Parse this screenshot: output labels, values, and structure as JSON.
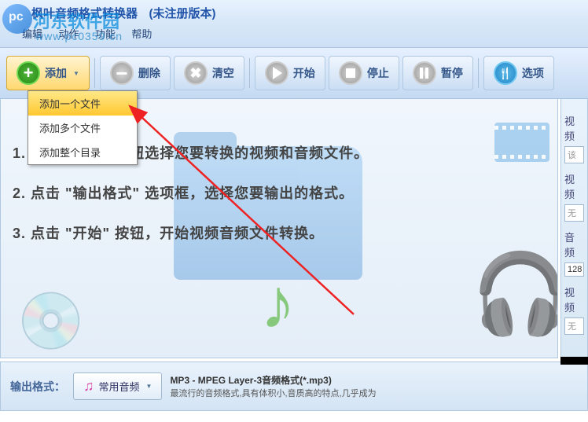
{
  "watermark": {
    "brand": "河东软件园",
    "url": "www.pc0359.cn"
  },
  "title": {
    "main": "枫叶音频格式转换器",
    "status": "(未注册版本)"
  },
  "menu": [
    "编辑",
    "动作",
    "功能",
    "帮助"
  ],
  "toolbar": {
    "add": "添加",
    "delete": "删除",
    "clear": "清空",
    "start": "开始",
    "stop": "停止",
    "pause": "暂停",
    "options": "选项"
  },
  "dropdown": {
    "items": [
      "添加一个文件",
      "添加多个文件",
      "添加整个目录"
    ]
  },
  "instructions": [
    "1. 点击 \"添加\" 按钮选择您要转换的视频和音频文件。",
    "2. 点击 \"输出格式\" 选项框，选择您要输出的格式。",
    "3. 点击 \"开始\" 按钮，开始视频音频文件转换。"
  ],
  "side": {
    "label1": "视频",
    "field1": "该",
    "label2": "视频",
    "field2": "无",
    "label3": "音频",
    "field3": "128",
    "label4": "视频",
    "field4": "无"
  },
  "output": {
    "label": "输出格式：",
    "category": "常用音频",
    "format_title": "MP3 - MPEG Layer-3音频格式(*.mp3)",
    "format_desc": "最流行的音频格式,具有体积小,音质高的特点,几乎成为"
  }
}
